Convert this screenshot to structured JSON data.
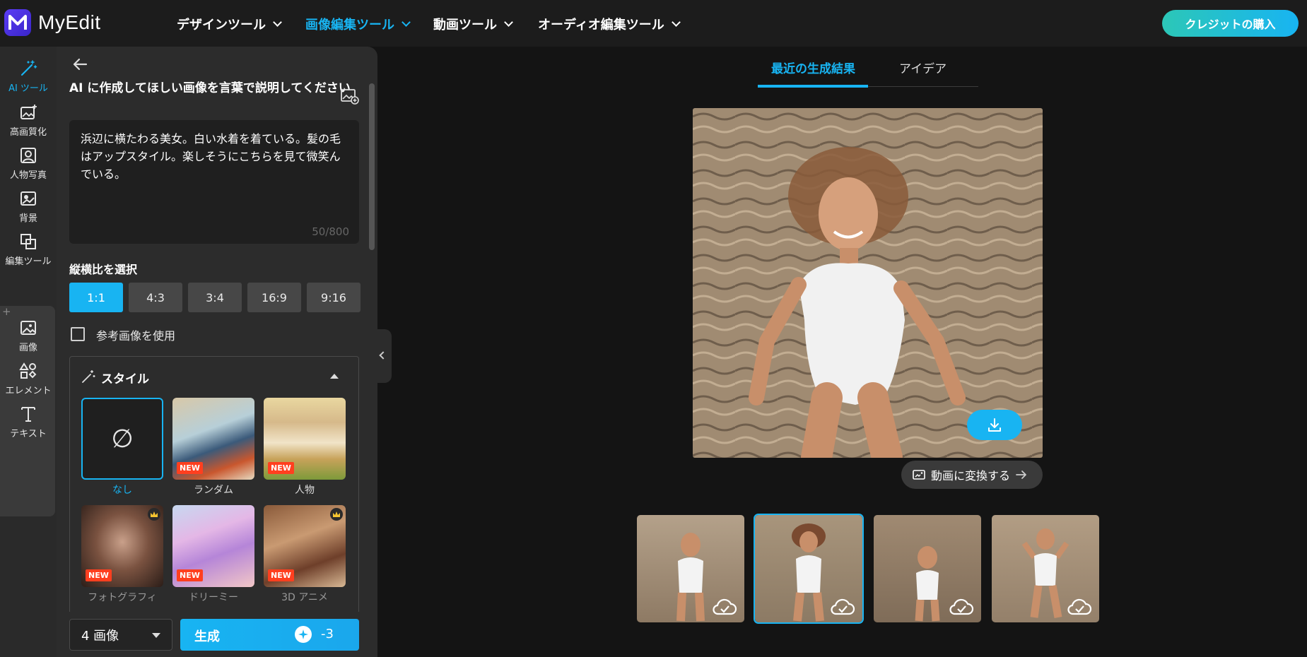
{
  "app": {
    "name": "MyEdit"
  },
  "nav": [
    {
      "label": "デザインツール"
    },
    {
      "label": "画像編集ツール"
    },
    {
      "label": "動画ツール"
    },
    {
      "label": "オーディオ編集ツール"
    }
  ],
  "buy_label": "クレジットの購入",
  "rail": [
    {
      "label": "AI ツール",
      "icon": "magic-wand-icon"
    },
    {
      "label": "高画質化",
      "icon": "image-enhance-icon"
    },
    {
      "label": "人物写真",
      "icon": "portrait-icon"
    },
    {
      "label": "背景",
      "icon": "background-icon"
    },
    {
      "label": "編集ツール",
      "icon": "edit-tools-icon"
    },
    {
      "label": "画像",
      "icon": "image-icon"
    },
    {
      "label": "エレメント",
      "icon": "elements-icon"
    },
    {
      "label": "テキスト",
      "icon": "text-icon"
    }
  ],
  "rail_plus": "+",
  "panel": {
    "prompt_label": "AI に作成してほしい画像を言葉で説明してください",
    "prompt_text": "浜辺に横たわる美女。白い水着を着ている。髪の毛はアップスタイル。楽しそうにこちらを見て微笑んでいる。",
    "prompt_count": "50/800",
    "ratio_label": "縦横比を選択",
    "ratios": [
      "1:1",
      "4:3",
      "3:4",
      "16:9",
      "9:16"
    ],
    "reference_label": "参考画像を使用",
    "style_title": "スタイル",
    "none_symbol": "∅",
    "new_badge": "NEW",
    "styles": [
      {
        "name": "なし"
      },
      {
        "name": "ランダム"
      },
      {
        "name": "人物"
      },
      {
        "name": "フォトグラフィ"
      },
      {
        "name": "ドリーミー"
      },
      {
        "name": "3D アニメ"
      }
    ],
    "count_value": "4 画像",
    "generate_label": "生成",
    "generate_cost": "-3"
  },
  "main": {
    "tabs": [
      "最近の生成結果",
      "アイデア"
    ],
    "convert_label": "動画に変換する"
  },
  "colors": {
    "accent": "#18b4f2",
    "brand": "#4b30e0",
    "new_badge": "#ff3f1f"
  }
}
